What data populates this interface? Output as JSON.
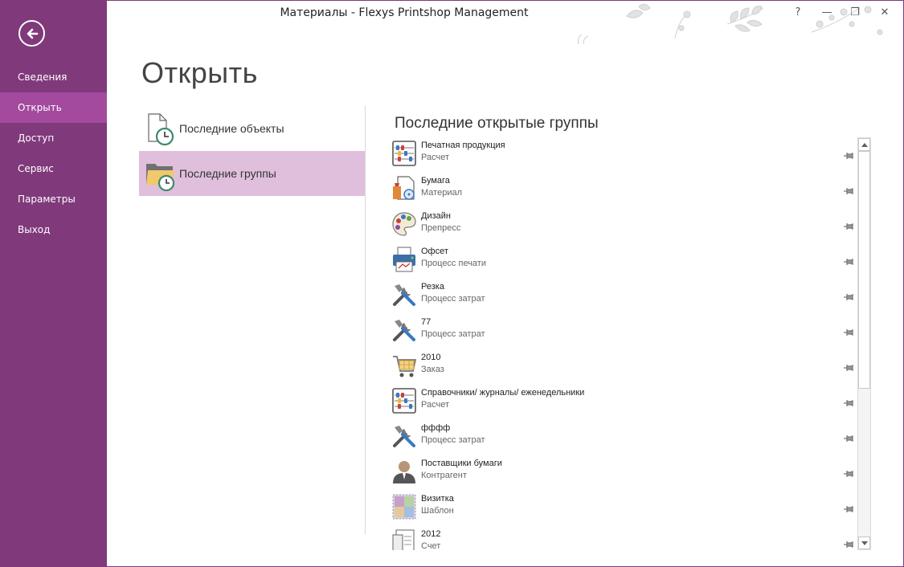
{
  "window": {
    "title": "Материалы - Flexys Printshop Management",
    "help_label": "?",
    "minimize_label": "—",
    "maximize_label": "❐",
    "close_label": "✕"
  },
  "sidebar": {
    "back_icon": "arrow-left-circle-icon",
    "items": [
      {
        "label": "Сведения",
        "active": false
      },
      {
        "label": "Открыть",
        "active": true
      },
      {
        "label": "Доступ",
        "active": false
      },
      {
        "label": "Сервис",
        "active": false
      },
      {
        "label": "Параметры",
        "active": false
      },
      {
        "label": "Выход",
        "active": false
      }
    ]
  },
  "page": {
    "title": "Открыть"
  },
  "options": [
    {
      "label": "Последние объекты",
      "icon": "recent-document-icon",
      "selected": false
    },
    {
      "label": "Последние группы",
      "icon": "recent-folder-icon",
      "selected": true
    }
  ],
  "recent_groups": {
    "title": "Последние открытые группы",
    "items": [
      {
        "name": "Печатная продукция",
        "type": "Расчет",
        "icon": "abacus-icon"
      },
      {
        "name": "Бумага",
        "type": "Материал",
        "icon": "paper-material-icon"
      },
      {
        "name": "Дизайн",
        "type": "Препресс",
        "icon": "palette-icon"
      },
      {
        "name": "Офсет",
        "type": "Процесс печати",
        "icon": "printer-icon"
      },
      {
        "name": "Резка",
        "type": "Процесс затрат",
        "icon": "tools-icon"
      },
      {
        "name": "77",
        "type": "Процесс затрат",
        "icon": "tools-icon"
      },
      {
        "name": "2010",
        "type": "Заказ",
        "icon": "shopping-cart-icon"
      },
      {
        "name": "Справочники/ журналы/ еженедельники",
        "type": "Расчет",
        "icon": "abacus-icon"
      },
      {
        "name": "фффф",
        "type": "Процесс затрат",
        "icon": "tools-icon"
      },
      {
        "name": "Поставщики бумаги",
        "type": "Контрагент",
        "icon": "person-icon"
      },
      {
        "name": "Визитка",
        "type": "Шаблон",
        "icon": "template-puzzle-icon"
      },
      {
        "name": "2012",
        "type": "Счет",
        "icon": "invoice-icon"
      }
    ]
  },
  "colors": {
    "sidebar": "#80397b",
    "sidebar_active": "#a34a9e",
    "option_selected": "#e0bfdd"
  }
}
